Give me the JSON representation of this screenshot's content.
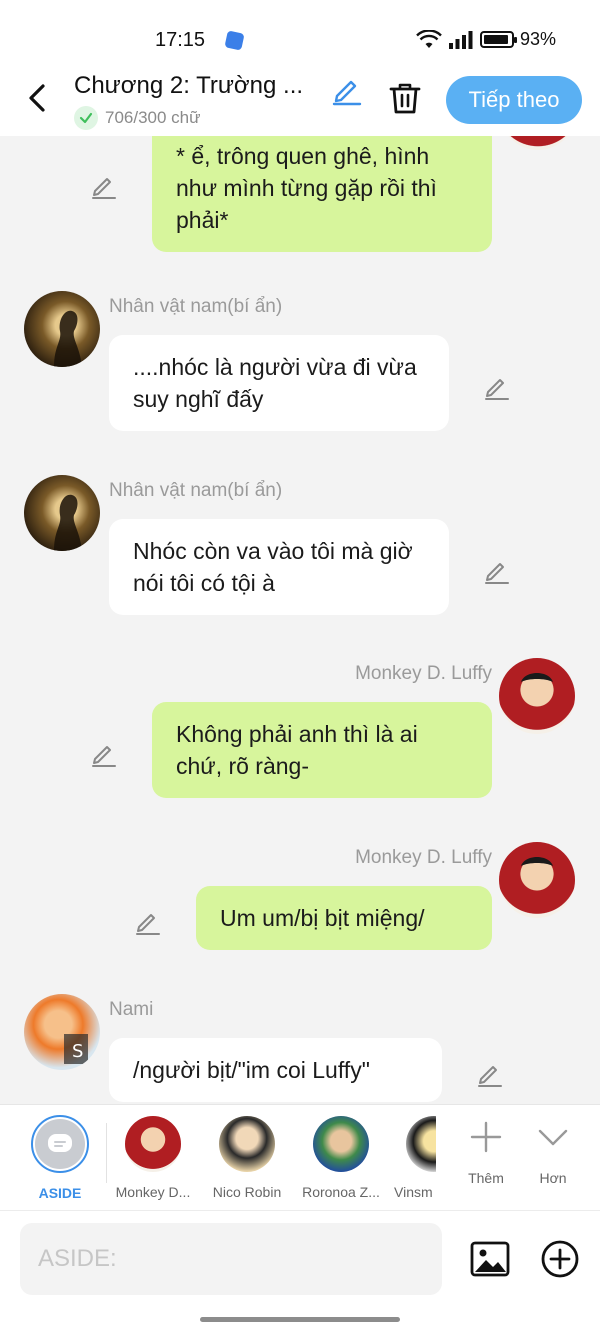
{
  "status_bar": {
    "time": "17:15",
    "battery": "93%",
    "battery_level": 0.93
  },
  "header": {
    "title": "Chương 2: Trường ...",
    "word_count": "706/300 chữ",
    "next_label": "Tiếp theo"
  },
  "messages": [
    {
      "side": "right",
      "sender": "",
      "text": "* ể, trông quen ghê, hình như mình từng gặp rồi thì phải*"
    },
    {
      "side": "left",
      "sender": "Nhân vật nam(bí ẩn)",
      "text": "....nhóc là người vừa đi vừa suy nghĩ đấy"
    },
    {
      "side": "left",
      "sender": "Nhân vật nam(bí ẩn)",
      "text": "Nhóc còn va vào tôi mà giờ nói tôi có tội à"
    },
    {
      "side": "right",
      "sender": "Monkey D. Luffy",
      "text": "Không phải anh thì là ai chứ, rõ ràng-"
    },
    {
      "side": "right",
      "sender": "Monkey D. Luffy",
      "text": "Um um/bị bịt miệng/"
    },
    {
      "side": "left",
      "sender": "Nami",
      "text": "/người bịt/\"im coi Luffy\""
    }
  ],
  "character_bar": {
    "aside_label": "ASIDE",
    "characters": [
      "Monkey D...",
      "Nico Robin",
      "Roronoa Z...",
      "Vinsm"
    ],
    "add_label": "Thêm",
    "more_label": "Hơn"
  },
  "input": {
    "placeholder": "ASIDE:",
    "value": ""
  },
  "colors": {
    "accent": "#5ab0f3",
    "bubble_green": "#d7f59c",
    "bubble_white": "#ffffff",
    "background": "#f3f3f3"
  }
}
